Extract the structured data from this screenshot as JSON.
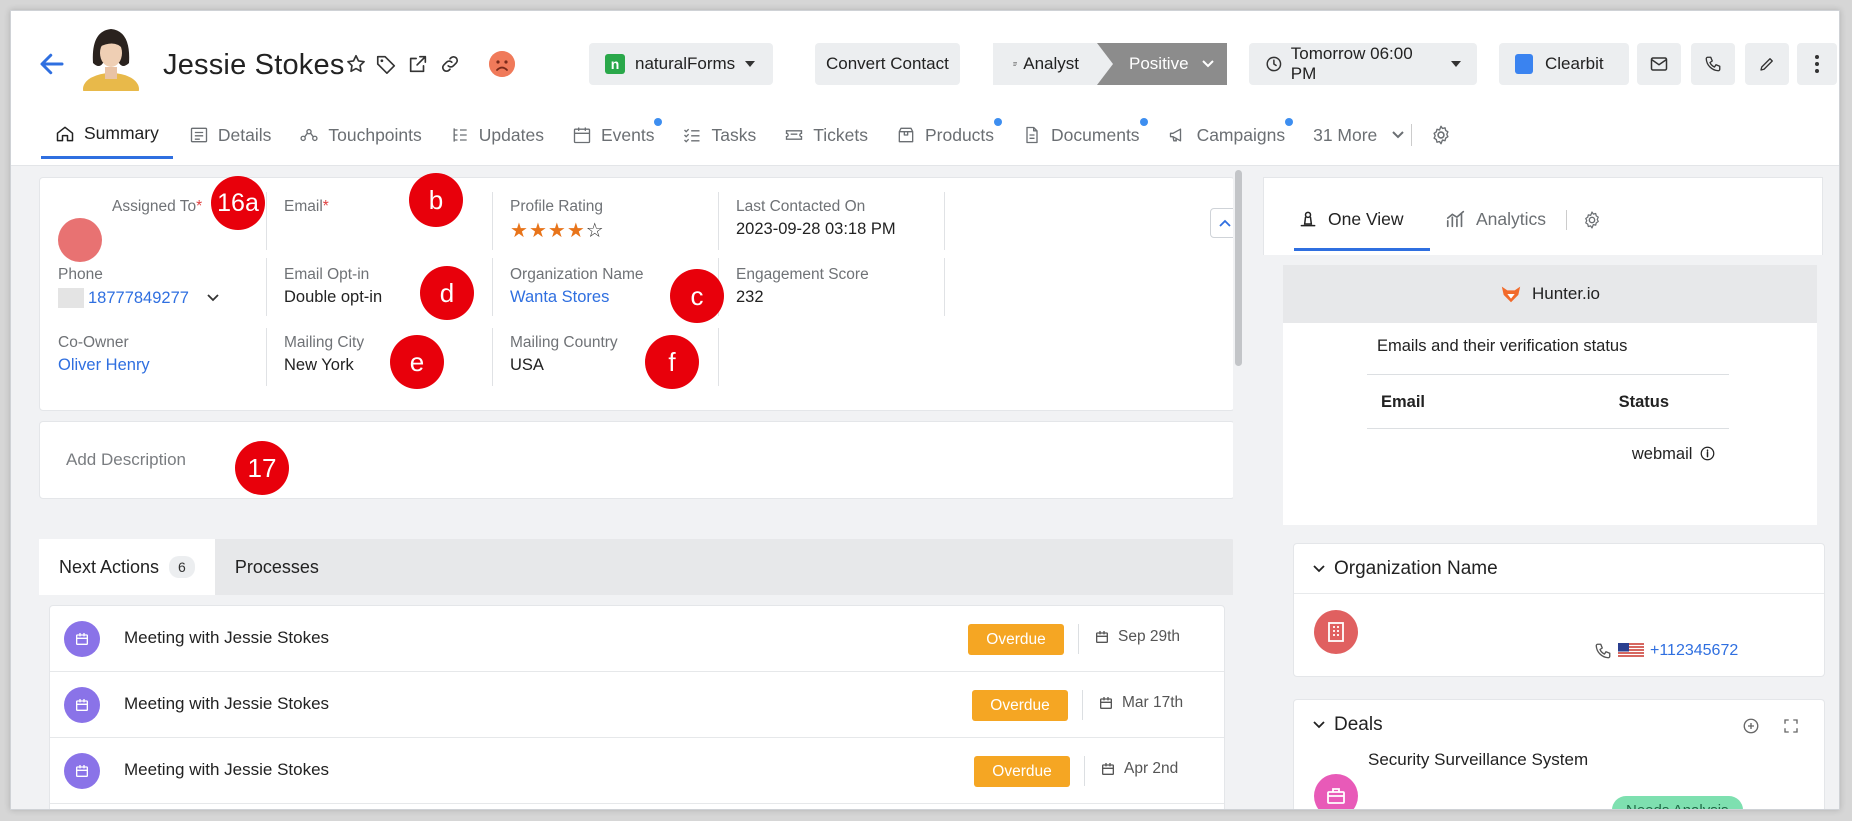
{
  "header": {
    "contact_name": "Jessie Stokes",
    "natural_forms_label": "naturalForms",
    "convert_label": "Convert Contact",
    "stage_prev": "Analyst",
    "stage_current": "Positive",
    "reminder_label": "Tomorrow 06:00 PM",
    "clearbit_label": "Clearbit"
  },
  "tabs": [
    {
      "label": "Summary",
      "icon": "home-icon"
    },
    {
      "label": "Details",
      "icon": "list-icon"
    },
    {
      "label": "Touchpoints",
      "icon": "network-icon"
    },
    {
      "label": "Updates",
      "icon": "updates-icon"
    },
    {
      "label": "Events",
      "icon": "calendar-icon"
    },
    {
      "label": "Tasks",
      "icon": "tasks-icon"
    },
    {
      "label": "Tickets",
      "icon": "ticket-icon"
    },
    {
      "label": "Products",
      "icon": "box-icon"
    },
    {
      "label": "Documents",
      "icon": "document-icon"
    },
    {
      "label": "Campaigns",
      "icon": "megaphone-icon"
    },
    {
      "label": "31 More",
      "icon": "chevron-down-icon"
    }
  ],
  "fields": {
    "assigned_to": {
      "label": "Assigned To",
      "req": "*"
    },
    "email": {
      "label": "Email",
      "req": "*"
    },
    "profile_rating": {
      "label": "Profile Rating",
      "stars_filled": 4,
      "stars_total": 5
    },
    "last_contacted": {
      "label": "Last Contacted On",
      "value": "2023-09-28 03:18 PM"
    },
    "phone": {
      "label": "Phone",
      "value": "18777849277"
    },
    "email_optin": {
      "label": "Email Opt-in",
      "value": "Double opt-in"
    },
    "org_name": {
      "label": "Organization Name",
      "value": "Wanta Stores"
    },
    "engagement": {
      "label": "Engagement Score",
      "value": "232"
    },
    "co_owner": {
      "label": "Co-Owner",
      "value": "Oliver Henry"
    },
    "mailing_city": {
      "label": "Mailing City",
      "value": "New York"
    },
    "mailing_country": {
      "label": "Mailing Country",
      "value": "USA"
    }
  },
  "badges": {
    "b16a": "16a",
    "b": "b",
    "c": "c",
    "d": "d",
    "e": "e",
    "f": "f",
    "b17": "17"
  },
  "description_placeholder": "Add Description",
  "actions": {
    "tab_next": "Next Actions",
    "tab_next_count": "6",
    "tab_processes": "Processes",
    "rows": [
      {
        "title": "Meeting with Jessie Stokes",
        "status": "Overdue",
        "date": "Sep 29th"
      },
      {
        "title": "Meeting with Jessie Stokes",
        "status": "Overdue",
        "date": "Mar 17th"
      },
      {
        "title": "Meeting with Jessie Stokes",
        "status": "Overdue",
        "date": "Apr 2nd"
      }
    ]
  },
  "right": {
    "tab_one_view": "One View",
    "tab_analytics": "Analytics",
    "hunter_title": "Hunter.io",
    "hunter_caption": "Emails and their verification status",
    "col_email": "Email",
    "col_status": "Status",
    "status_value": "webmail",
    "org_card_title": "Organization Name",
    "org_phone": "+112345672",
    "deals_title": "Deals",
    "deal_name": "Security Surveillance System",
    "deal_stage": "Needs Analysis"
  },
  "colors": {
    "accent": "#2f6fe0",
    "badge": "#e8000b",
    "overdue": "#f5a623",
    "star": "#e8741a",
    "event_circle": "#8a73e8"
  }
}
